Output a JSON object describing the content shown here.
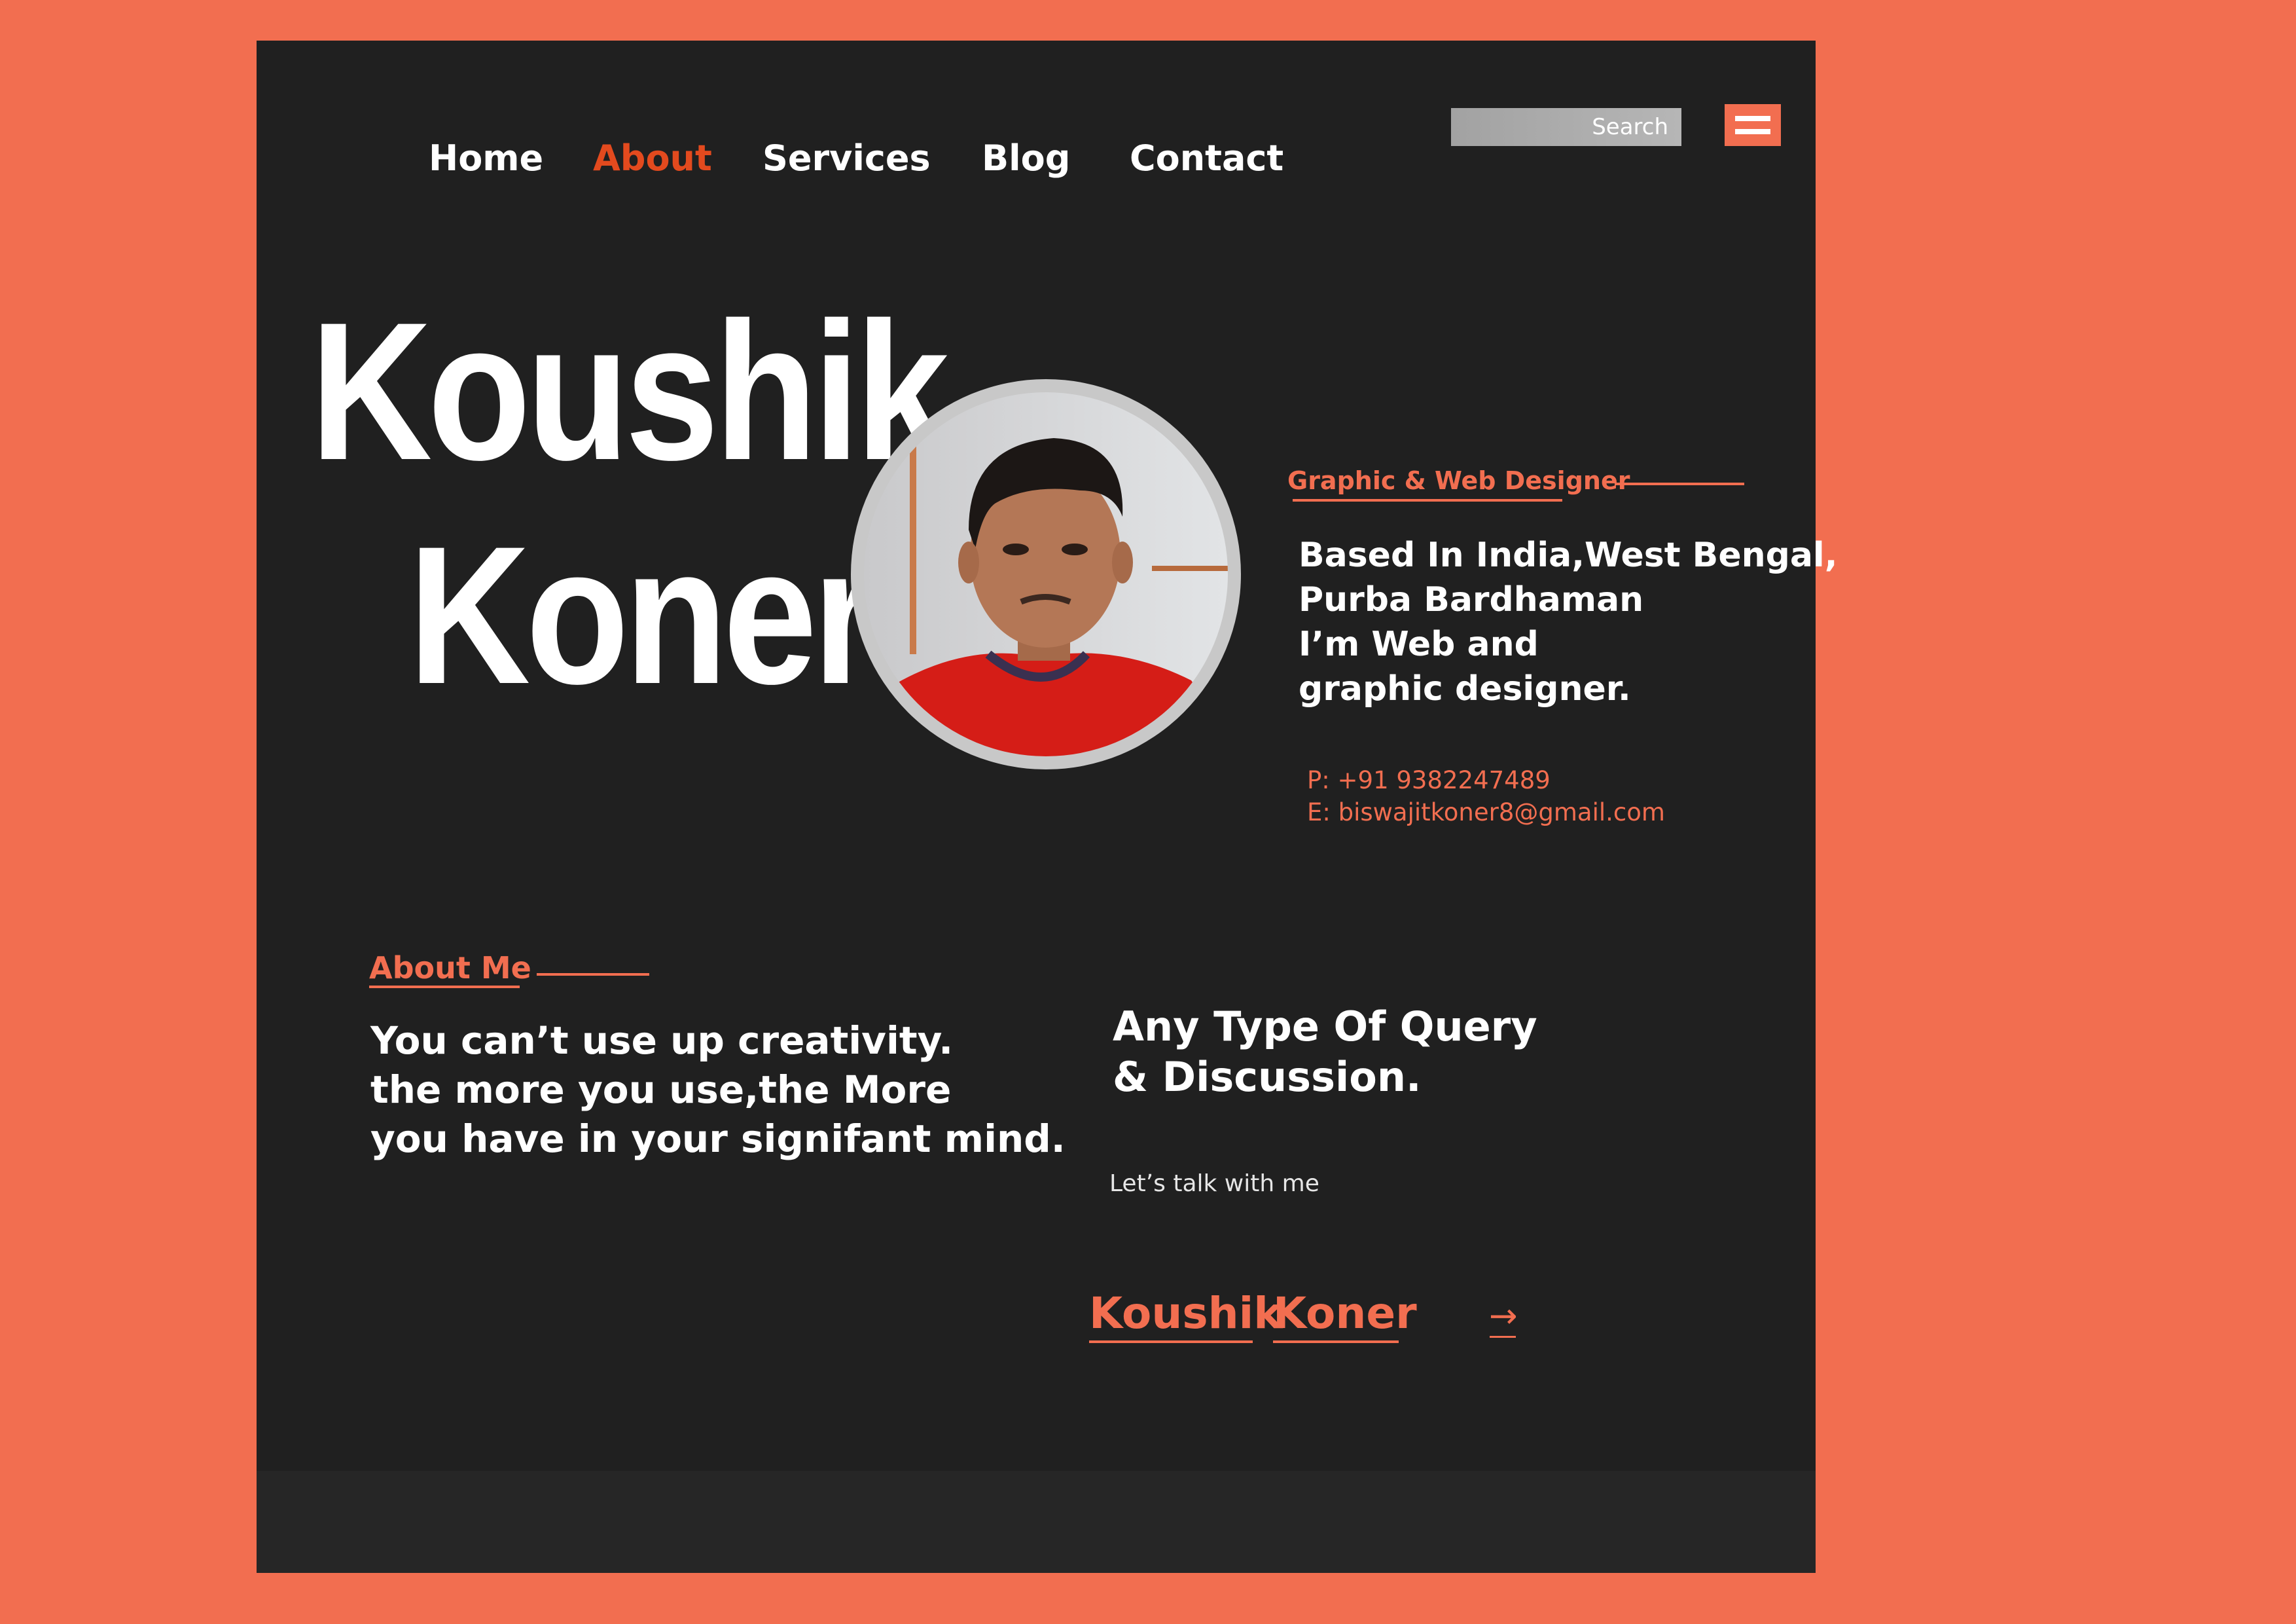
{
  "nav": {
    "items": [
      {
        "label": "Home",
        "active": false
      },
      {
        "label": "About",
        "active": true
      },
      {
        "label": "Services",
        "active": false
      },
      {
        "label": "Blog",
        "active": false
      },
      {
        "label": "Contact",
        "active": false
      }
    ],
    "search_placeholder": "Search",
    "menu_icon": "hamburger-icon"
  },
  "hero": {
    "first_name": "Koushik",
    "last_name": "Koner",
    "role": "Graphic & Web Designer",
    "bio_lines": [
      "Based In India,West Bengal,",
      "Purba Bardhaman",
      "I’m Web and",
      "graphic designer."
    ],
    "phone": "P: +91 9382247489",
    "email": "E: biswajitkoner8@gmail.com"
  },
  "about": {
    "heading": "About Me",
    "quote_lines": [
      "You can’t use up creativity.",
      "the more you use,the More",
      "you have in your  signifant mind."
    ]
  },
  "query": {
    "title_lines": [
      "Any Type Of Query",
      "& Discussion."
    ],
    "subtitle": "Let’s talk with me",
    "link_first": "Koushik",
    "link_last": "Koner",
    "arrow_icon": "arrow-right-icon"
  },
  "colors": {
    "background": "#f26e50",
    "panel": "#202020",
    "accent": "#f26e50",
    "active_nav": "#e34a1e"
  }
}
